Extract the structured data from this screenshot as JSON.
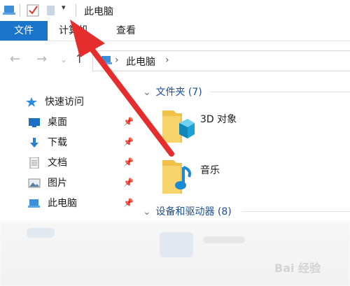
{
  "window": {
    "title": "此电脑"
  },
  "ribbon": {
    "tabs": [
      "文件",
      "计算机",
      "查看"
    ]
  },
  "address": {
    "crumb": "此电脑"
  },
  "sidebar": {
    "items": [
      {
        "label": "快速访问",
        "icon": "star-icon"
      },
      {
        "label": "桌面",
        "icon": "desktop-icon"
      },
      {
        "label": "下载",
        "icon": "download-icon"
      },
      {
        "label": "文档",
        "icon": "document-icon"
      },
      {
        "label": "图片",
        "icon": "picture-icon"
      },
      {
        "label": "此电脑",
        "icon": "computer-icon"
      }
    ]
  },
  "content": {
    "folders_header": "文件夹 (7)",
    "folders": [
      {
        "name": "3D 对象",
        "icon": "3d-objects-folder-icon"
      },
      {
        "name": "音乐",
        "icon": "music-folder-icon"
      }
    ],
    "devices_header": "设备和驱动器 (8)"
  },
  "colors": {
    "accent": "#1a74c9",
    "arrow": "#e52d2d",
    "section_text": "#1e4f91"
  },
  "watermark": "Bai 经验"
}
